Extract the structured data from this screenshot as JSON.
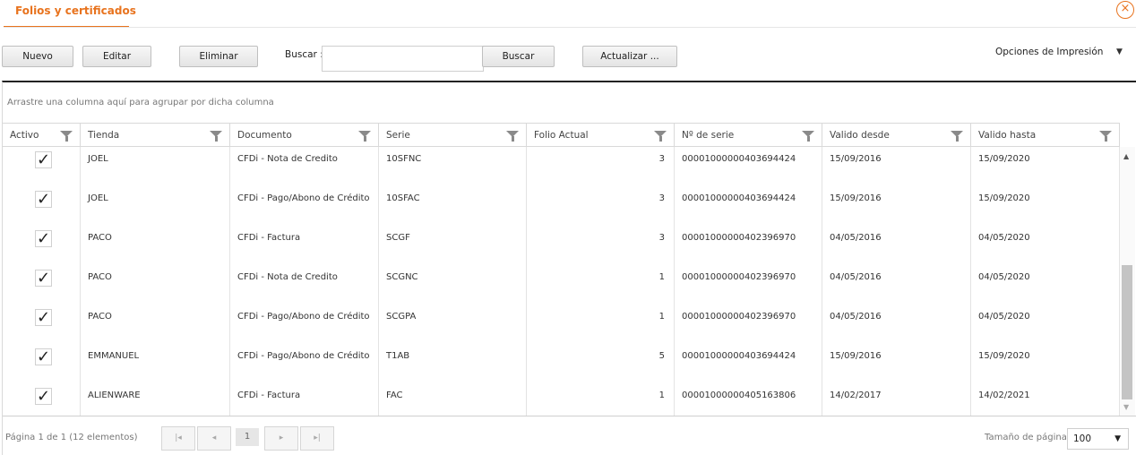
{
  "tab": {
    "title": "Folios y certificados",
    "close": "×"
  },
  "toolbar": {
    "new_label": "Nuevo",
    "edit_label": "Editar",
    "delete_label": "Eliminar",
    "search_label": "Buscar :",
    "search_value": "",
    "search_button": "Buscar",
    "refresh_label": "Actualizar ...",
    "print_options": "Opciones de Impresión"
  },
  "grid": {
    "group_hint": "Arrastre una columna aquí para agrupar por dicha columna",
    "columns": [
      "Activo",
      "Tienda",
      "Documento",
      "Serie",
      "Folio Actual",
      "Nº de serie",
      "Valido desde",
      "Valido hasta"
    ],
    "rows": [
      {
        "active": true,
        "tienda": "JOEL",
        "documento": "CFDi - Nota de Credito",
        "serie": "10SFNC",
        "folio": "3",
        "no_serie": "00001000000403694424",
        "desde": "15/09/2016",
        "hasta": "15/09/2020"
      },
      {
        "active": true,
        "tienda": "JOEL",
        "documento": "CFDi - Pago/Abono de Crédito",
        "serie": "10SFAC",
        "folio": "3",
        "no_serie": "00001000000403694424",
        "desde": "15/09/2016",
        "hasta": "15/09/2020"
      },
      {
        "active": true,
        "tienda": "PACO",
        "documento": "CFDi - Factura",
        "serie": "SCGF",
        "folio": "3",
        "no_serie": "00001000000402396970",
        "desde": "04/05/2016",
        "hasta": "04/05/2020"
      },
      {
        "active": true,
        "tienda": "PACO",
        "documento": "CFDi - Nota de Credito",
        "serie": "SCGNC",
        "folio": "1",
        "no_serie": "00001000000402396970",
        "desde": "04/05/2016",
        "hasta": "04/05/2020"
      },
      {
        "active": true,
        "tienda": "PACO",
        "documento": "CFDi - Pago/Abono de Crédito",
        "serie": "SCGPA",
        "folio": "1",
        "no_serie": "00001000000402396970",
        "desde": "04/05/2016",
        "hasta": "04/05/2020"
      },
      {
        "active": true,
        "tienda": "EMMANUEL",
        "documento": "CFDi - Pago/Abono de Crédito",
        "serie": "T1AB",
        "folio": "5",
        "no_serie": "00001000000403694424",
        "desde": "15/09/2016",
        "hasta": "15/09/2020"
      },
      {
        "active": true,
        "tienda": "ALIENWARE",
        "documento": "CFDi - Factura",
        "serie": "FAC",
        "folio": "1",
        "no_serie": "00001000000405163806",
        "desde": "14/02/2017",
        "hasta": "14/02/2021"
      }
    ],
    "check_glyph": "✓"
  },
  "pager": {
    "info": "Página 1 de 1 (12 elementos)",
    "first": "|◂",
    "prev": "◂",
    "page": "1",
    "next": "▸",
    "last": "▸|",
    "size_label": "Tamaño de página:",
    "size_value": "100"
  },
  "colors": {
    "accent": "#e8731e"
  }
}
